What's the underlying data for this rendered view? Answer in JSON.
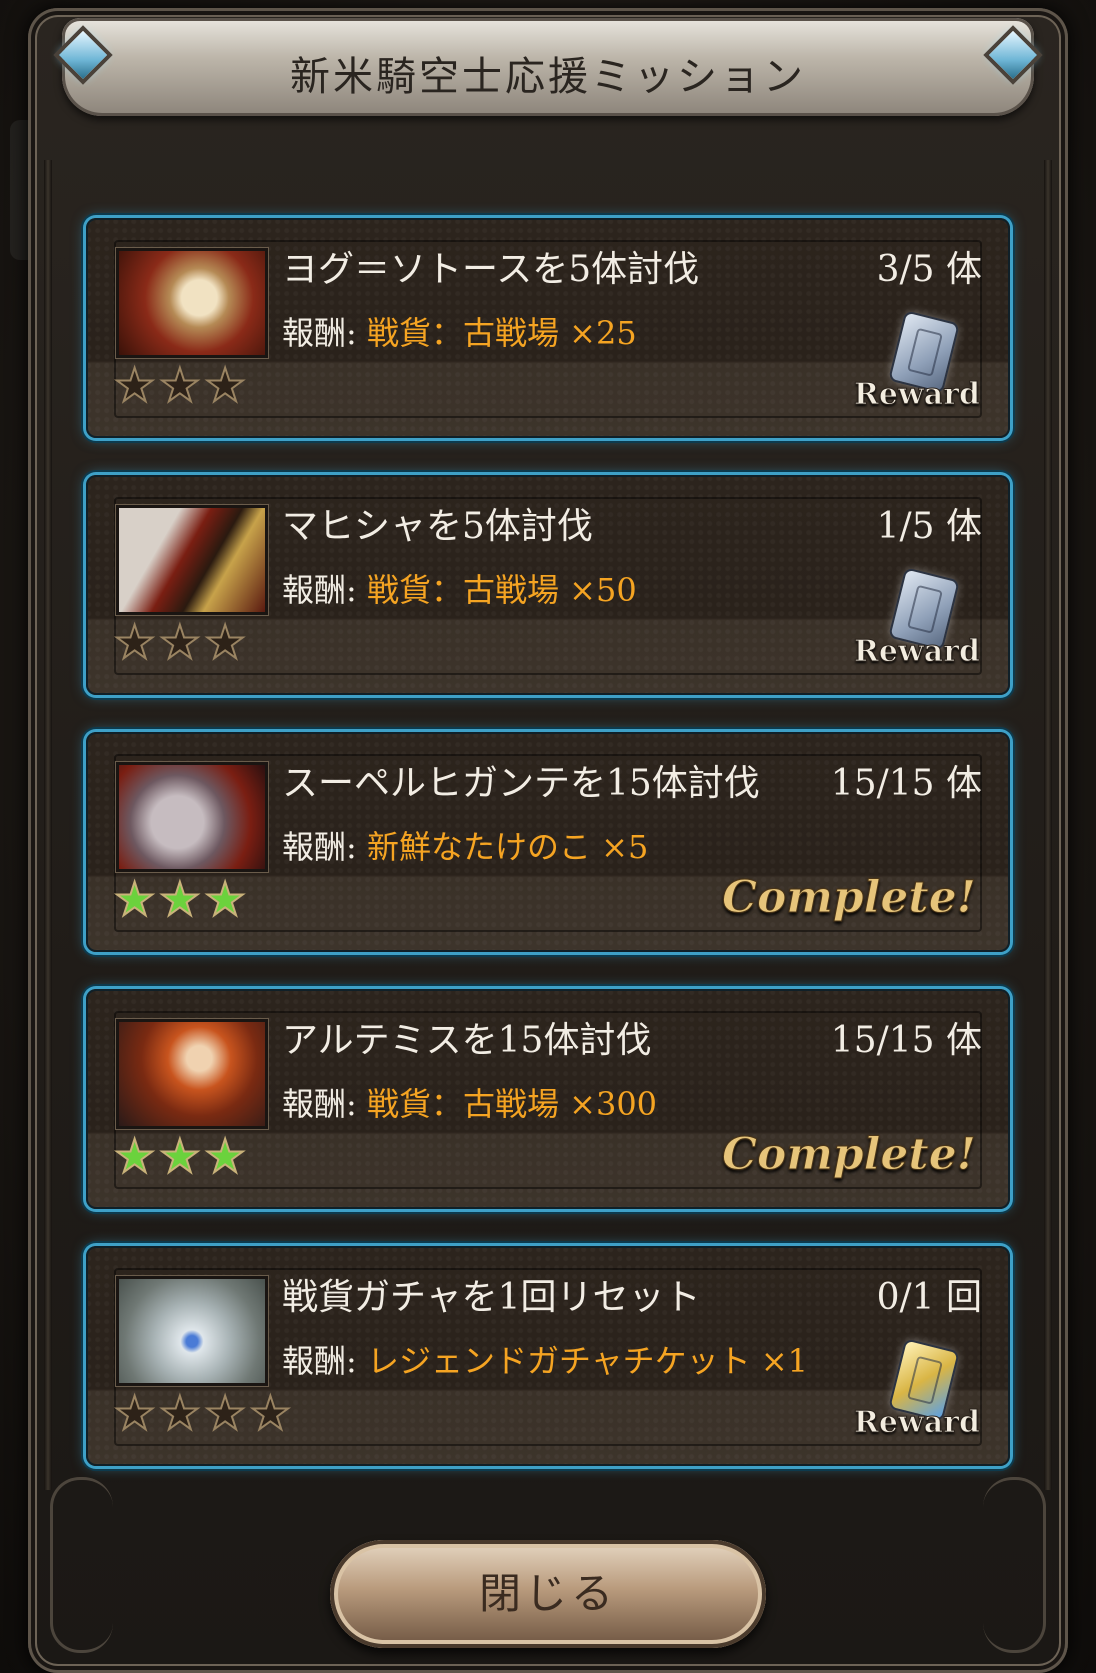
{
  "header": {
    "title": "新米騎空士応援ミッション"
  },
  "reward_prefix": "報酬:",
  "missions": [
    {
      "title": "ヨグ＝ソトースを5体討伐",
      "progress": "3/5 体",
      "reward_item": "戦貨：古戦場 ×25",
      "stars_total": 3,
      "stars_earned": 0,
      "status": "Reward",
      "badge_icon": "silver-ticket-icon"
    },
    {
      "title": "マヒシャを5体討伐",
      "progress": "1/5 体",
      "reward_item": "戦貨：古戦場 ×50",
      "stars_total": 3,
      "stars_earned": 0,
      "status": "Reward",
      "badge_icon": "silver-ticket-icon"
    },
    {
      "title": "スーペルヒガンテを15体討伐",
      "progress": "15/15 体",
      "reward_item": "新鮮なたけのこ ×5",
      "stars_total": 3,
      "stars_earned": 3,
      "status": "Complete!"
    },
    {
      "title": "アルテミスを15体討伐",
      "progress": "15/15 体",
      "reward_item": "戦貨：古戦場 ×300",
      "stars_total": 3,
      "stars_earned": 3,
      "status": "Complete!"
    },
    {
      "title": "戦貨ガチャを1回リセット",
      "progress": "0/1 回",
      "reward_item": "レジェンドガチャチケット ×1",
      "stars_total": 4,
      "stars_earned": 0,
      "status": "Reward",
      "badge_icon": "gold-ticket-icon"
    }
  ],
  "footer": {
    "close_label": "閉じる"
  },
  "colors": {
    "card_border": "#3ea0c7",
    "reward_item": "#f5a422",
    "star_earned": "#6bd23d",
    "complete_text": "#e6c47a"
  }
}
